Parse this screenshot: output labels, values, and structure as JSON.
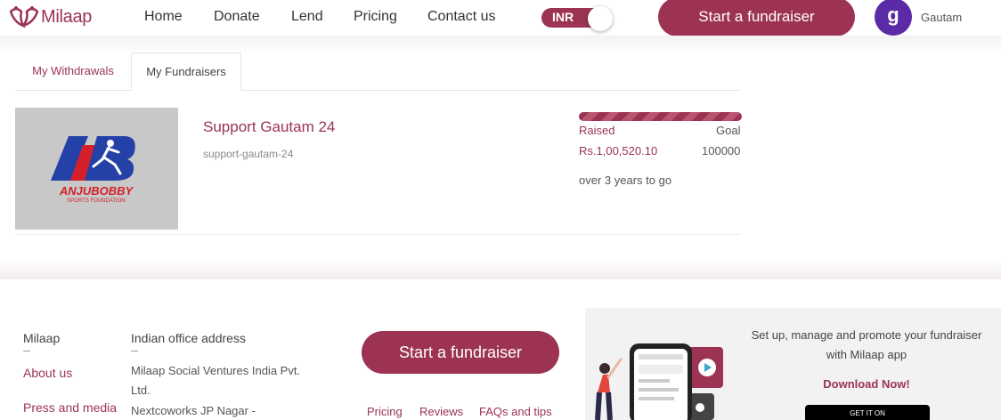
{
  "header": {
    "brand": "Milaap",
    "nav": [
      "Home",
      "Donate",
      "Lend",
      "Pricing",
      "Contact us"
    ],
    "currency_toggle": "INR",
    "cta": "Start a fundraiser",
    "avatar_initial": "g",
    "username": "Gautam"
  },
  "tabs": [
    "My Withdrawals",
    "My Fundraisers"
  ],
  "active_tab": "My Fundraisers",
  "fundraiser": {
    "logo_text_main": "ANJUBOBBY",
    "logo_text_sub": "SPORTS FOUNDATION",
    "title": "Support Gautam 24",
    "slug": "support-gautam-24",
    "raised_label": "Raised",
    "goal_label": "Goal",
    "raised_value": "Rs.1,00,520.10",
    "goal_value": "100000",
    "time_left": "over 3 years to go",
    "progress_percent": 100
  },
  "footer": {
    "col1_title": "Milaap",
    "col1_links": [
      "About us",
      "Press and media"
    ],
    "col2_title": "Indian office address",
    "address_lines": [
      "Milaap Social Ventures India Pvt.",
      "Ltd.",
      "Nextcoworks JP Nagar -"
    ],
    "cta": "Start a fundraiser",
    "links": [
      "Pricing",
      "Reviews",
      "FAQs and tips"
    ],
    "app_text": "Set up, manage and promote your fundraiser with Milaap app",
    "download": "Download Now!",
    "play_badge": "GET IT ON"
  },
  "colors": {
    "brand": "#9c3353",
    "avatar": "#5b2aa6"
  }
}
